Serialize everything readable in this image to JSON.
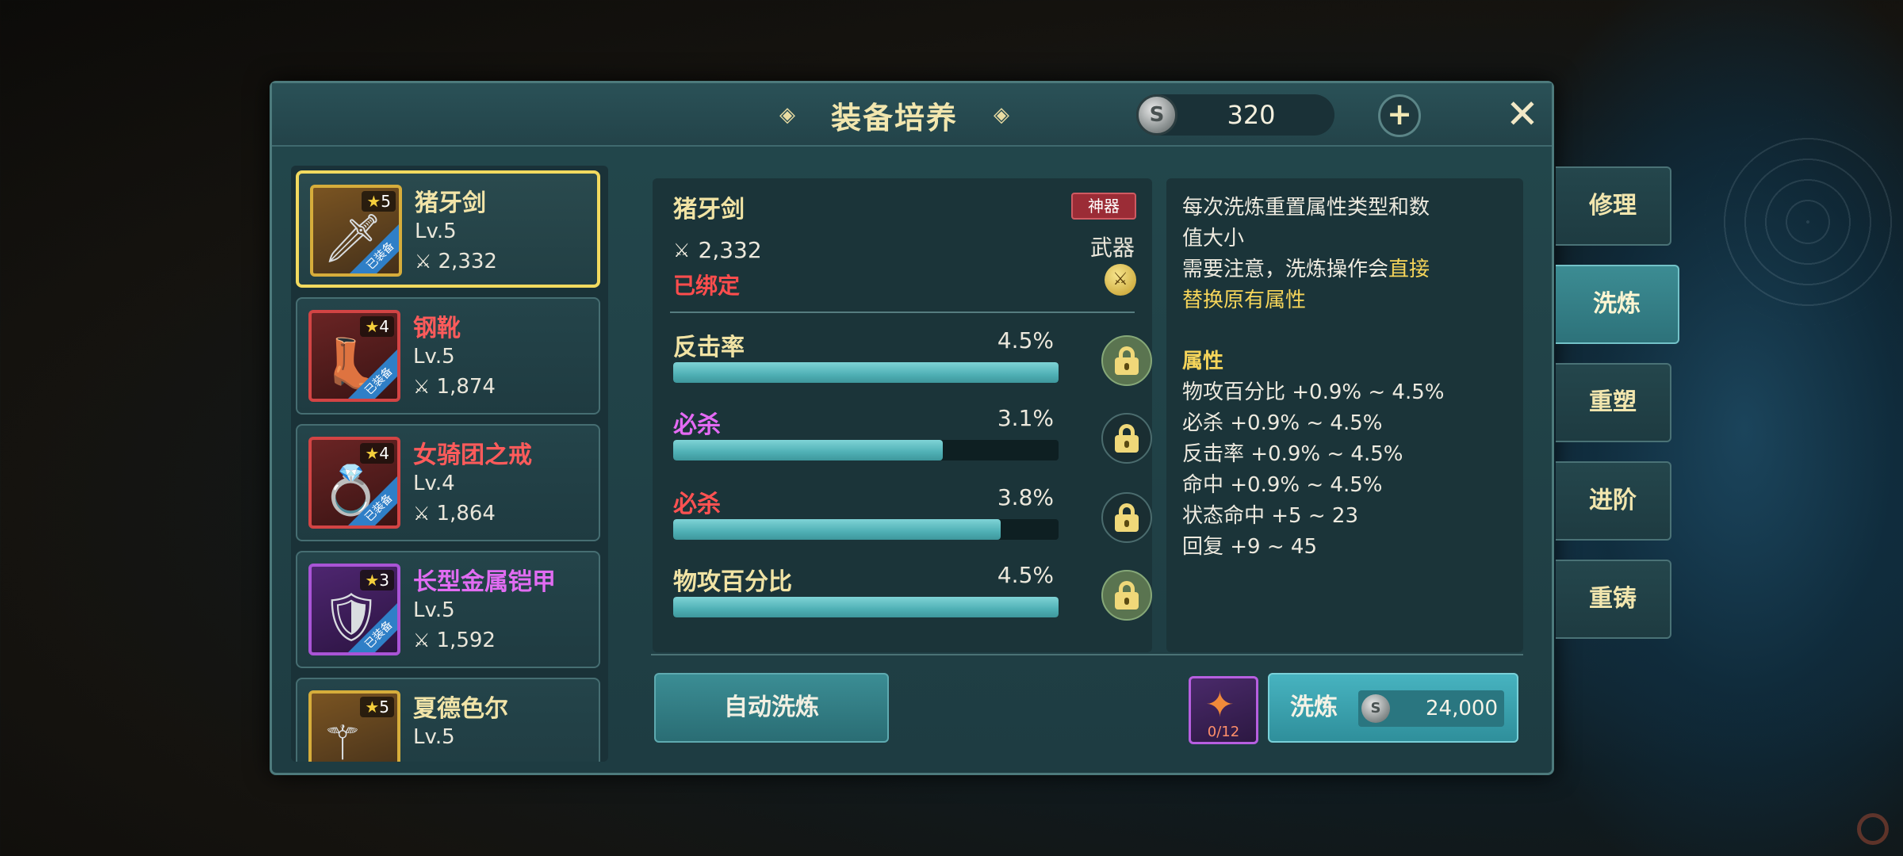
{
  "header": {
    "title": "装备培养",
    "currency_value": "320",
    "coin_icon": "silver-coin-icon",
    "plus_label": "+",
    "close_label": "✕"
  },
  "items": [
    {
      "name": "猪牙剑",
      "level": "Lv.5",
      "power": "2,332",
      "stars": "5",
      "equipped": "已装备",
      "rarity_color": "#c9a338",
      "icon": "sword-icon"
    },
    {
      "name": "钢靴",
      "level": "Lv.5",
      "power": "1,874",
      "stars": "4",
      "equipped": "已装备",
      "rarity_color": "#d24444",
      "icon": "boots-icon"
    },
    {
      "name": "女骑团之戒",
      "level": "Lv.4",
      "power": "1,864",
      "stars": "4",
      "equipped": "已装备",
      "rarity_color": "#d24444",
      "icon": "ring-icon"
    },
    {
      "name": "长型金属铠甲",
      "level": "Lv.5",
      "power": "1,592",
      "stars": "3",
      "equipped": "已装备",
      "rarity_color": "#a954d6",
      "icon": "armor-icon"
    },
    {
      "name": "夏德色尔",
      "level": "Lv.5",
      "power": "",
      "stars": "5",
      "equipped": "",
      "rarity_color": "#d6ad3b",
      "icon": "staff-icon"
    }
  ],
  "detail": {
    "name": "猪牙剑",
    "rarity": "神器",
    "power": "2,332",
    "bound": "已绑定",
    "type": "武器",
    "attributes": [
      {
        "name": "反击率",
        "value": "4.5%",
        "fill": 1.0,
        "locked": true,
        "color": "#f1e3a4"
      },
      {
        "name": "必杀",
        "value": "3.1%",
        "fill": 0.7,
        "locked": false,
        "color": "#e46af4"
      },
      {
        "name": "必杀",
        "value": "3.8%",
        "fill": 0.85,
        "locked": false,
        "color": "#ff5252"
      },
      {
        "name": "物攻百分比",
        "value": "4.5%",
        "fill": 1.0,
        "locked": true,
        "color": "#f1e3a4"
      }
    ]
  },
  "info": {
    "desc_line1": "每次洗炼重置属性类型和数",
    "desc_line2": "值大小",
    "desc_line3_a": "需要注意，洗炼操作会",
    "desc_line3_b": "直接",
    "desc_line4": "替换原有属性",
    "section_title": "属性",
    "attr_ranges": [
      "物攻百分比 +0.9% ~ 4.5%",
      "必杀 +0.9% ~ 4.5%",
      "反击率 +0.9% ~ 4.5%",
      "命中 +0.9% ~ 4.5%",
      "状态命中 +5 ~ 23",
      "回复 +9 ~ 45"
    ]
  },
  "actions": {
    "auto_refine": "自动洗炼",
    "material_count": "0/12",
    "refine_label": "洗炼",
    "refine_cost": "24,000"
  },
  "side_tabs": [
    {
      "label": "修理",
      "active": false
    },
    {
      "label": "洗炼",
      "active": true
    },
    {
      "label": "重塑",
      "active": false
    },
    {
      "label": "进阶",
      "active": false
    },
    {
      "label": "重铸",
      "active": false
    }
  ]
}
